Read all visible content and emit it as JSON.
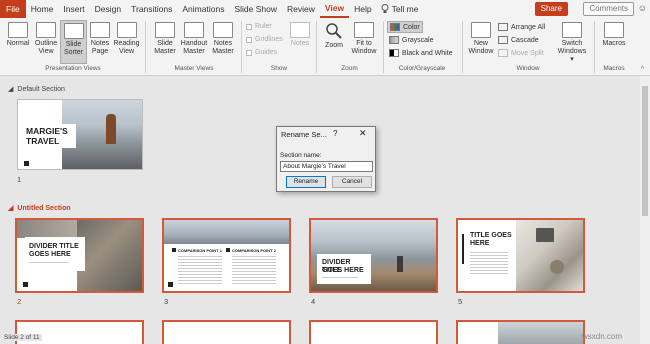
{
  "tabs": [
    {
      "label": "File"
    },
    {
      "label": "Home"
    },
    {
      "label": "Insert"
    },
    {
      "label": "Design"
    },
    {
      "label": "Transitions"
    },
    {
      "label": "Animations"
    },
    {
      "label": "Slide Show"
    },
    {
      "label": "Review"
    },
    {
      "label": "View"
    },
    {
      "label": "Help"
    }
  ],
  "search": {
    "icon": "lightbulb-icon",
    "label": "Tell me"
  },
  "share_label": "Share",
  "comments_label": "Comments",
  "ribbon": {
    "presentation_views": {
      "label": "Presentation Views",
      "normal": "Normal",
      "outline1": "Outline",
      "outline2": "View",
      "sorter1": "Slide",
      "sorter2": "Sorter",
      "notes1": "Notes",
      "notes2": "Page",
      "reading1": "Reading",
      "reading2": "View"
    },
    "master_views": {
      "label": "Master Views",
      "slide1": "Slide",
      "slide2": "Master",
      "handout1": "Handout",
      "handout2": "Master",
      "notes1": "Notes",
      "notes2": "Master"
    },
    "show": {
      "label": "Show",
      "ruler": "Ruler",
      "gridlines": "Gridlines",
      "guides": "Guides",
      "notes": "Notes"
    },
    "zoom": {
      "label": "Zoom",
      "zoom": "Zoom",
      "fit1": "Fit to",
      "fit2": "Window"
    },
    "color": {
      "label": "Color/Grayscale",
      "color": "Color",
      "grayscale": "Grayscale",
      "bw": "Black and White"
    },
    "window": {
      "label": "Window",
      "new1": "New",
      "new2": "Window",
      "arrange": "Arrange All",
      "cascade": "Cascade",
      "move_split": "Move Split",
      "switch1": "Switch",
      "switch2": "Windows"
    },
    "macros": {
      "label": "Macros",
      "macros": "Macros"
    }
  },
  "sections": {
    "default": "Default Section",
    "untitled": "Untitled Section"
  },
  "slides": [
    {
      "number": "1",
      "title1": "MARGIE'S",
      "title2": "TRAVEL"
    },
    {
      "number": "2",
      "title1": "DIVIDER TITLE",
      "title2": "GOES HERE"
    },
    {
      "number": "3",
      "col1": "COMPARISON POINT 1",
      "col2": "COMPARISON POINT 2"
    },
    {
      "number": "4",
      "title1": "DIVIDER TITLE",
      "title2": "GOES HERE"
    },
    {
      "number": "5",
      "title1": "TITLE GOES",
      "title2": "HERE"
    }
  ],
  "dialog": {
    "title": "Rename Se...",
    "help": "?",
    "close": "✕",
    "label": "Section name:",
    "value": "About Margie's Travel",
    "rename": "Rename",
    "cancel": "Cancel"
  },
  "status": "Slide 2 of 11",
  "watermark": "wsxdn.com",
  "colors": {
    "accent": "#c43e1c",
    "highlight": "#d25a3a"
  }
}
